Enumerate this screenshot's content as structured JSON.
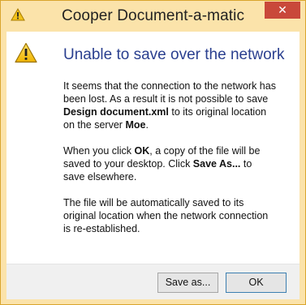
{
  "window": {
    "title": "Cooper Document-a-matic",
    "close_label": "✕"
  },
  "message": {
    "heading": "Unable to save over the network",
    "p1_a": "It seems that the connection to the network has been lost. As a result it is not possible to save ",
    "p1_file": "Design document.xml",
    "p1_b": " to its original location on the server ",
    "p1_server": "Moe",
    "p1_c": ".",
    "p2_a": "When you click ",
    "p2_ok": "OK",
    "p2_b": ", a copy of the file will be saved to your desktop. Click ",
    "p2_saveas": "Save As...",
    "p2_c": " to save elsewhere.",
    "p3": "The file will be automatically saved to its original location when the network connection is re-established."
  },
  "buttons": {
    "save_as": "Save as...",
    "ok": "OK"
  },
  "icons": {
    "title": "warning-icon",
    "content": "warning-icon"
  },
  "colors": {
    "frame": "#fbe3aa",
    "close": "#c9483a",
    "heading": "#2a3f8f"
  }
}
